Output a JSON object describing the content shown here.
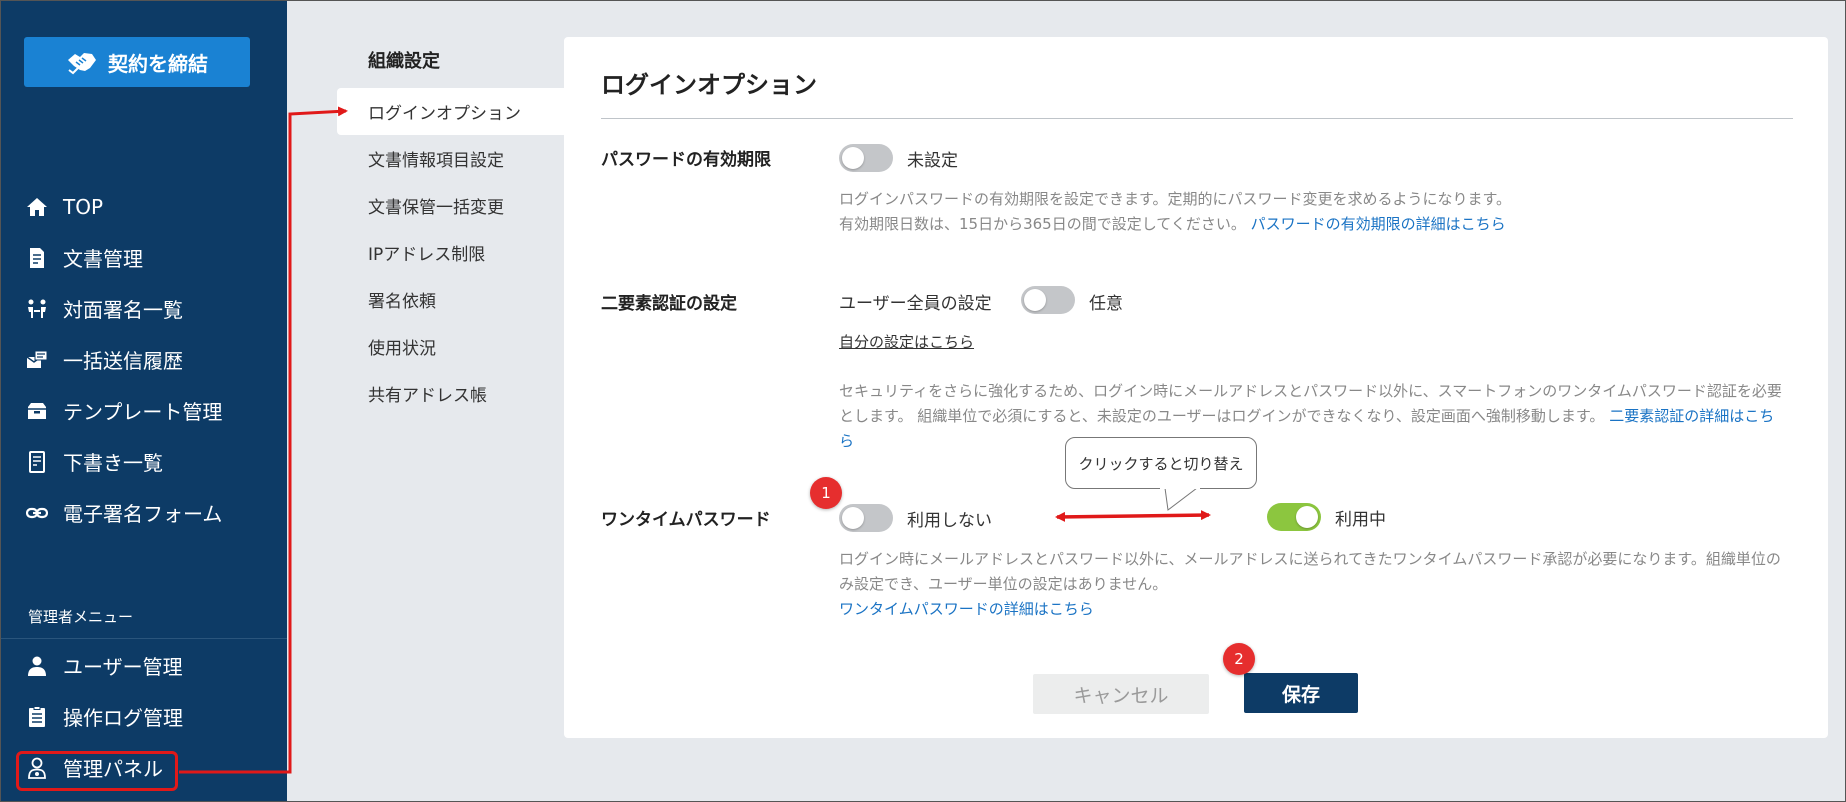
{
  "sidebar": {
    "contract_button": "契約を締結",
    "nav": [
      {
        "label": "TOP",
        "icon": "home-icon"
      },
      {
        "label": "文書管理",
        "icon": "document-icon"
      },
      {
        "label": "対面署名一覧",
        "icon": "face-to-face-icon"
      },
      {
        "label": "一括送信履歴",
        "icon": "bulk-send-icon"
      },
      {
        "label": "テンプレート管理",
        "icon": "template-icon"
      },
      {
        "label": "下書き一覧",
        "icon": "draft-icon"
      },
      {
        "label": "電子署名フォーム",
        "icon": "link-icon"
      }
    ],
    "admin_label": "管理者メニュー",
    "admin_nav": [
      {
        "label": "ユーザー管理",
        "icon": "user-icon"
      },
      {
        "label": "操作ログ管理",
        "icon": "log-icon"
      },
      {
        "label": "管理パネル",
        "icon": "admin-user-icon"
      }
    ]
  },
  "submenu": {
    "title": "組織設定",
    "items": [
      {
        "label": "ログインオプション",
        "active": true
      },
      {
        "label": "文書情報項目設定"
      },
      {
        "label": "文書保管一括変更"
      },
      {
        "label": "IPアドレス制限"
      },
      {
        "label": "署名依頼"
      },
      {
        "label": "使用状況"
      },
      {
        "label": "共有アドレス帳"
      }
    ]
  },
  "main": {
    "title": "ログインオプション",
    "password_expiry": {
      "label": "パスワードの有効期限",
      "toggle_state": "off",
      "toggle_label": "未設定",
      "desc_line1": "ログインパスワードの有効期限を設定できます。定期的にパスワード変更を求めるようになります。",
      "desc_line2": "有効期限日数は、15日から365日の間で設定してください。",
      "link": "パスワードの有効期限の詳細はこちら"
    },
    "two_factor": {
      "label": "二要素認証の設定",
      "all_users_label": "ユーザー全員の設定",
      "toggle_state": "off",
      "toggle_label": "任意",
      "own_settings_link": "自分の設定はこちら",
      "desc_line1": "セキュリティをさらに強化するため、ログイン時にメールアドレスとパスワード以外に、スマートフォンのワンタイムパスワード認証を必要",
      "desc_line2": "とします。 組織単位で必須にすると、未設定のユーザーはログインができなくなり、設定画面へ強制移動します。",
      "link_part1": "二要素認証の詳細はこち",
      "link_part2": "ら"
    },
    "one_time_password": {
      "label": "ワンタイムパスワード",
      "toggle_off_label": "利用しない",
      "toggle_on_label": "利用中",
      "desc_line1": "ログイン時にメールアドレスとパスワード以外に、メールアドレスに送られてきたワンタイムパスワード承認が必要になります。組織単位の",
      "desc_line2": "み設定でき、ユーザー単位の設定はありません。",
      "link": "ワンタイムパスワードの詳細はこちら"
    },
    "cancel_button": "キャンセル",
    "save_button": "保存"
  },
  "annotations": {
    "badge1": "1",
    "badge2": "2",
    "callout": "クリックすると切り替え",
    "accent_color": "#e01919"
  }
}
